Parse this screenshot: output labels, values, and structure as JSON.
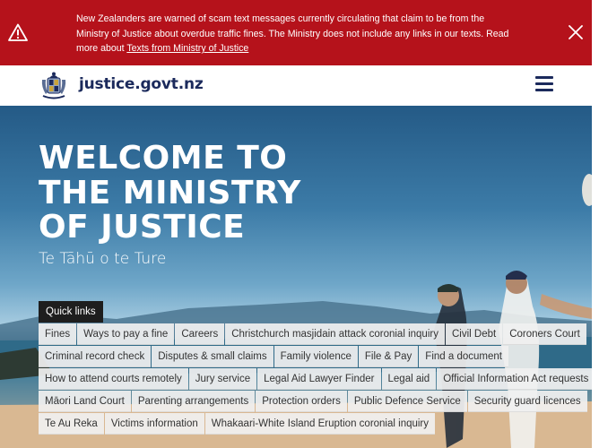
{
  "alert": {
    "message": "New Zealanders are warned of scam text messages currently circulating that claim to be from the Ministry of Justice about overdue traffic fines. The Ministry does not include any links in our texts. Read more about ",
    "link_label": "Texts from Ministry of Justice",
    "icon": "warning-icon",
    "close_icon": "close-icon"
  },
  "header": {
    "site_name": "justice.govt.nz",
    "logo": "nz-coat-of-arms",
    "menu_icon": "hamburger-menu-icon"
  },
  "hero": {
    "title": "Welcome to the Ministry of Justice",
    "subtitle": "Te Tāhū o te Ture"
  },
  "quick_links": {
    "label": "Quick links",
    "rows": [
      [
        "Fines",
        "Ways to pay a fine",
        "Careers",
        "Christchurch masjidain attack coronial inquiry",
        "Civil Debt",
        "Coroners Court"
      ],
      [
        "Criminal record check",
        "Disputes & small claims",
        "Family violence",
        "File & Pay",
        "Find a document"
      ],
      [
        "How to attend courts remotely",
        "Jury service",
        "Legal Aid Lawyer Finder",
        "Legal aid",
        "Official Information Act requests"
      ],
      [
        "Māori Land Court",
        "Parenting arrangements",
        "Protection orders",
        "Public Defence Service",
        "Security guard licences"
      ],
      [
        "Te Au Reka",
        "Victims information",
        "Whakaari-White Island Eruption coronial inquiry"
      ]
    ]
  },
  "colors": {
    "alert_bg": "#b5121b",
    "brand_navy": "#1b2a5c",
    "quick_links_label_bg": "#1e1e1e"
  }
}
